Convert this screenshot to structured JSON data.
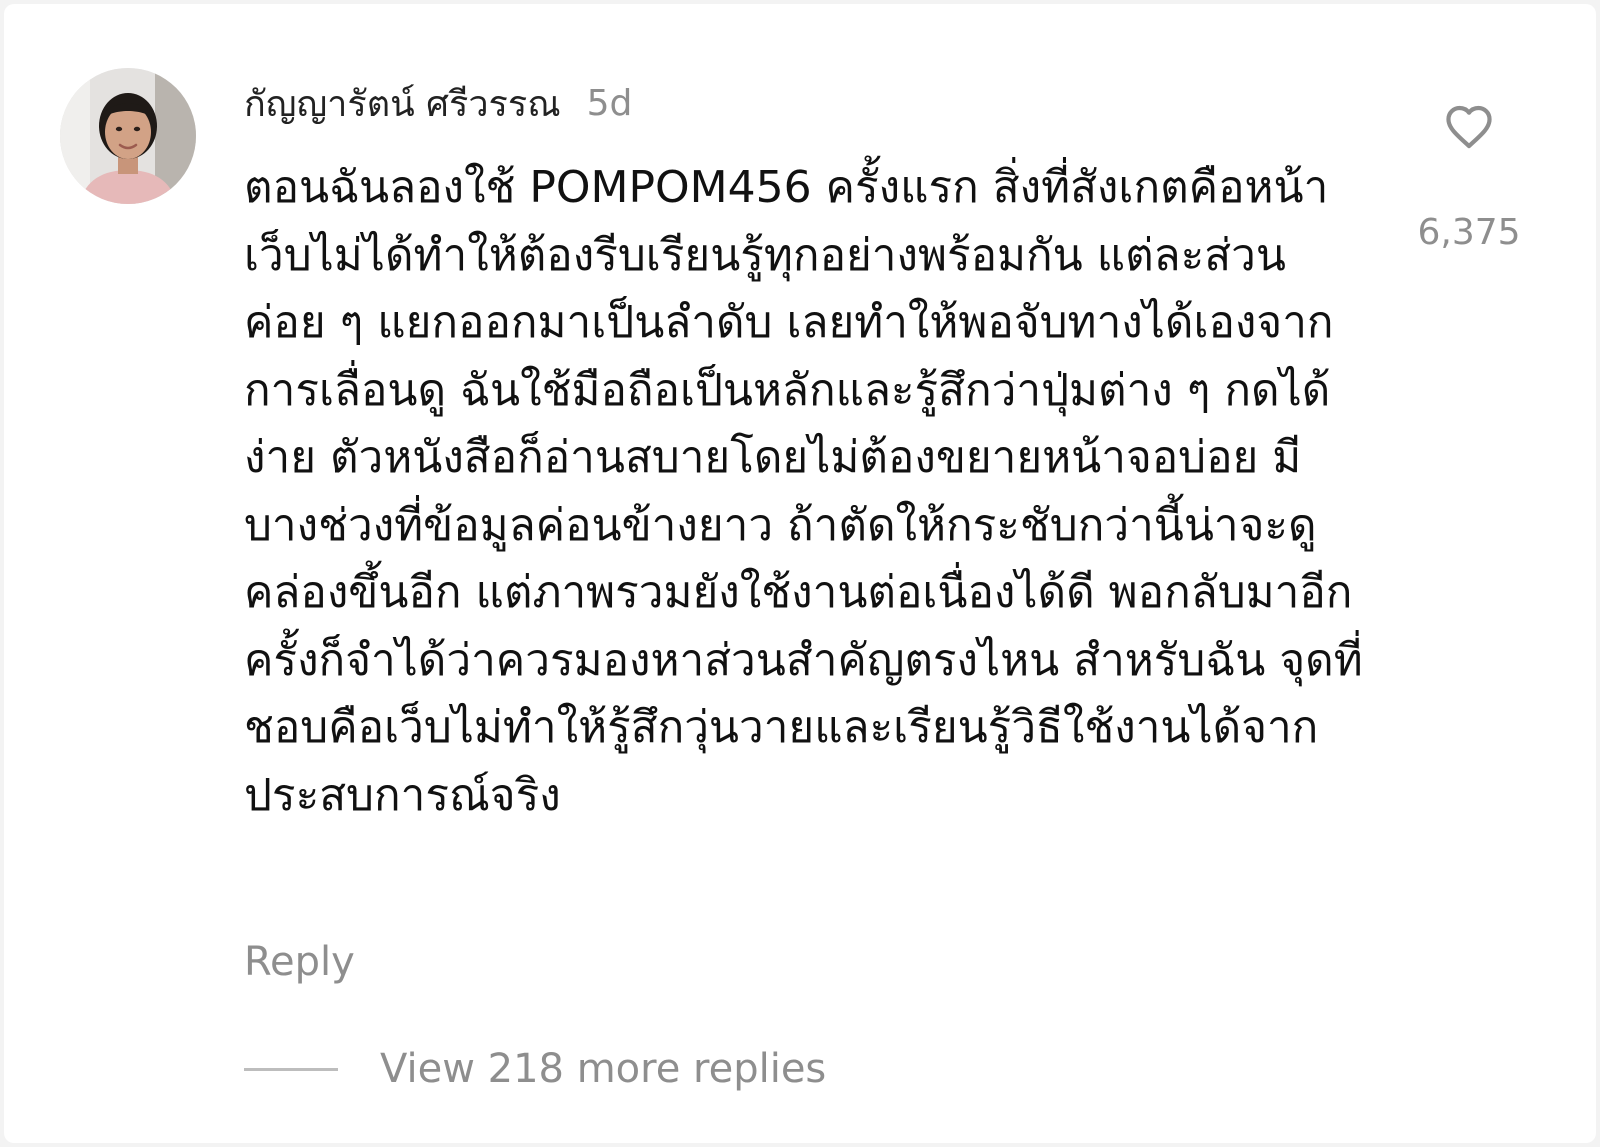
{
  "comment": {
    "avatar_icon": "user-portrait-avatar",
    "username": "กัญญารัตน์ ศรีวรรณ",
    "timestamp": "5d",
    "text": "ตอนฉันลองใช้ POMPOM456 ครั้งแรก สิ่งที่สังเกตคือหน้าเว็บไม่ได้ทำให้ต้องรีบเรียนรู้ทุกอย่างพร้อมกัน แต่ละส่วนค่อย ๆ แยกออกมาเป็นลำดับ เลยทำให้พอจับทางได้เองจากการเลื่อนดู ฉันใช้มือถือเป็นหลักและรู้สึกว่าปุ่มต่าง ๆ กดได้ง่าย ตัวหนังสือก็อ่านสบายโดยไม่ต้องขยายหน้าจอบ่อย มีบางช่วงที่ข้อมูลค่อนข้างยาว ถ้าตัดให้กระชับกว่านี้น่าจะดูคล่องขึ้นอีก แต่ภาพรวมยังใช้งานต่อเนื่องได้ดี พอกลับมาอีกครั้งก็จำได้ว่าควรมองหาส่วนสำคัญตรงไหน สำหรับฉัน จุดที่ชอบคือเว็บไม่ทำให้รู้สึกวุ่นวายและเรียนรู้วิธีใช้งานได้จากประสบการณ์จริง",
    "like_icon": "heart-outline-icon",
    "like_count": "6,375",
    "reply_label": "Reply",
    "view_replies_label": "View 218 more replies"
  },
  "colors": {
    "background": "#ffffff",
    "primary_text": "#111111",
    "secondary_text": "#8e8e8e"
  }
}
